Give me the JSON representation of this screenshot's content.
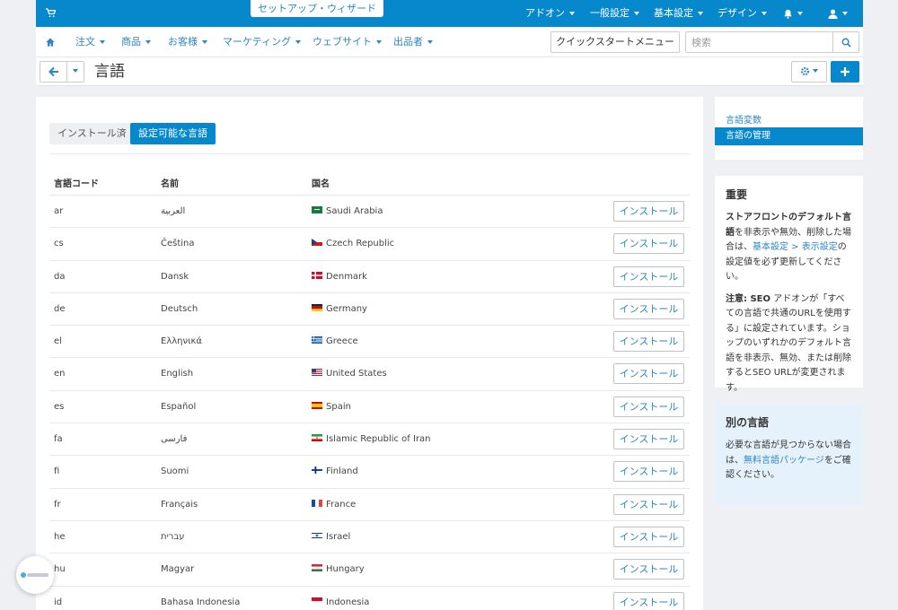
{
  "header": {
    "wizard_label": "セットアップ・ウィザード",
    "menus": [
      "アドオン",
      "一般設定",
      "基本設定",
      "デザイン"
    ],
    "icons": [
      "cart-icon",
      "bell-icon",
      "user-icon"
    ]
  },
  "nav": {
    "items": [
      "注文",
      "商品",
      "お客様",
      "マーケティング",
      "ウェブサイト",
      "出品者"
    ],
    "quick_start": "クイックスタートメニュー",
    "search_placeholder": "検索"
  },
  "page": {
    "title": "言語"
  },
  "tabs": {
    "installed": "インストール済",
    "available": "設定可能な言語"
  },
  "table": {
    "headers": {
      "code": "言語コード",
      "name": "名前",
      "country": "国名"
    },
    "install_label": "インストール",
    "rows": [
      {
        "code": "ar",
        "name": "العربية",
        "country": "Saudi Arabia",
        "flag": "flag-sa"
      },
      {
        "code": "cs",
        "name": "Čeština",
        "country": "Czech Republic",
        "flag": "flag-cz"
      },
      {
        "code": "da",
        "name": "Dansk",
        "country": "Denmark",
        "flag": "flag-dk"
      },
      {
        "code": "de",
        "name": "Deutsch",
        "country": "Germany",
        "flag": "flag-de"
      },
      {
        "code": "el",
        "name": "Ελληνικά",
        "country": "Greece",
        "flag": "flag-gr"
      },
      {
        "code": "en",
        "name": "English",
        "country": "United States",
        "flag": "flag-us"
      },
      {
        "code": "es",
        "name": "Español",
        "country": "Spain",
        "flag": "flag-es"
      },
      {
        "code": "fa",
        "name": "فارسی",
        "country": "Islamic Republic of Iran",
        "flag": "flag-ir"
      },
      {
        "code": "fi",
        "name": "Suomi",
        "country": "Finland",
        "flag": "flag-fi"
      },
      {
        "code": "fr",
        "name": "Français",
        "country": "France",
        "flag": "flag-fr"
      },
      {
        "code": "he",
        "name": "עברית",
        "country": "Israel",
        "flag": "flag-il"
      },
      {
        "code": "hu",
        "name": "Magyar",
        "country": "Hungary",
        "flag": "flag-hu"
      },
      {
        "code": "id",
        "name": "Bahasa Indonesia",
        "country": "Indonesia",
        "flag": "flag-id"
      }
    ]
  },
  "sidebar": {
    "links": [
      "言語変数",
      "言語の管理"
    ],
    "important": {
      "title": "重要",
      "p1_bold": "ストアフロントのデフォルト言語",
      "p1_a": "を非表示や無効、削除した場合は、",
      "p1_link1": "基本設定",
      "p1_sep": " > ",
      "p1_link2": "表示設定",
      "p1_b": "の設定値を必ず更新してください。",
      "p2_bold": "注意: SEO",
      "p2_text": " アドオンが「すべての言語で共通のURLを使用する」に設定されています。ショップのいずれかのデフォルト言語を非表示、無効、または削除するとSEO URLが変更されます。"
    },
    "other": {
      "title": "別の言語",
      "p_a": "必要な言語が見つからない場合は、",
      "p_link": "無料言語パッケージ",
      "p_b": "をご確認ください。"
    }
  },
  "colors": {
    "primary": "#0888cc",
    "link": "#2d86c4"
  }
}
